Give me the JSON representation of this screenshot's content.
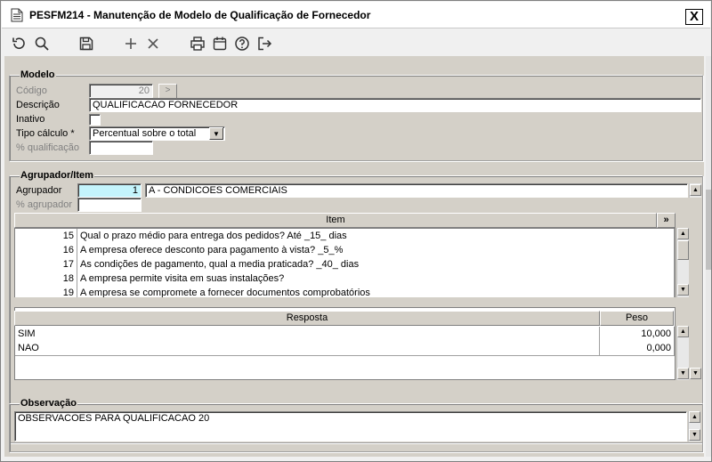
{
  "window": {
    "title": "PESFM214 - Manutenção de Modelo de Qualificação de Fornecedor",
    "close_label": "X"
  },
  "toolbar": {
    "icons": [
      "undo-icon",
      "search-icon",
      "save-icon",
      "add-icon",
      "delete-icon",
      "print-icon",
      "calendar-icon",
      "help-icon",
      "exit-icon"
    ]
  },
  "modelo": {
    "title": "Modelo",
    "codigo_label": "Código",
    "codigo_value": "20",
    "lookup_label": ">",
    "descricao_label": "Descrição",
    "descricao_value": "QUALIFICACAO FORNECEDOR",
    "inativo_label": "Inativo",
    "inativo_checked": false,
    "tipo_calculo_label": "Tipo cálculo *",
    "tipo_calculo_value": "Percentual sobre o total",
    "qualificacao_label": "% qualificação",
    "qualificacao_value": ""
  },
  "agrupador": {
    "title": "Agrupador/Item",
    "agrupador_label": "Agrupador",
    "agrupador_code": "1",
    "agrupador_desc": "A - CONDICOES COMERCIAIS",
    "perc_label": "% agrupador",
    "perc_value": "",
    "item_header": "Item",
    "expand_label": "»",
    "items": [
      {
        "num": "15",
        "text": "Qual o prazo médio para entrega dos pedidos? Até _15_ dias"
      },
      {
        "num": "16",
        "text": "A empresa oferece desconto para pagamento à vista? _5_%"
      },
      {
        "num": "17",
        "text": "As condições de pagamento, qual a media praticada? _40_ dias"
      },
      {
        "num": "18",
        "text": "A empresa permite visita em suas instalações?"
      },
      {
        "num": "19",
        "text": "A empresa se compromete a fornecer documentos comprobatórios"
      }
    ],
    "resposta_header": "Resposta",
    "peso_header": "Peso",
    "respostas": [
      {
        "resposta": "SIM",
        "peso": "10,000"
      },
      {
        "resposta": "NAO",
        "peso": "0,000"
      }
    ]
  },
  "observacao": {
    "title": "Observação",
    "value": "OBSERVACOES PARA QUALIFICACAO 20"
  },
  "colors": {
    "highlight": "#c4f4fc",
    "panel": "#d4d0c8"
  }
}
